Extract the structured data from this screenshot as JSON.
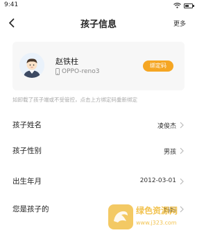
{
  "status_bar": {
    "time": "9:41"
  },
  "nav": {
    "title": "孩子信息",
    "more_label": "更多"
  },
  "child_card": {
    "name": "赵铁柱",
    "device": "OPPO-reno3",
    "bind_button": "绑定码"
  },
  "hint": "如卸载了孩子端或不受管控，点击上方绑定码重新绑定",
  "rows": [
    {
      "label": "孩子姓名",
      "value": "凌俊杰"
    },
    {
      "label": "孩子性别",
      "value": "男孩"
    },
    {
      "label": "出生年月",
      "value": "2012-03-01"
    },
    {
      "label": "您是孩子的",
      "value": "妈妈"
    }
  ],
  "watermark": {
    "text": "绿色资源网",
    "url": "www.j323.com"
  },
  "colors": {
    "accent": "#f5a623",
    "card_bg": "#f7f7f7"
  }
}
